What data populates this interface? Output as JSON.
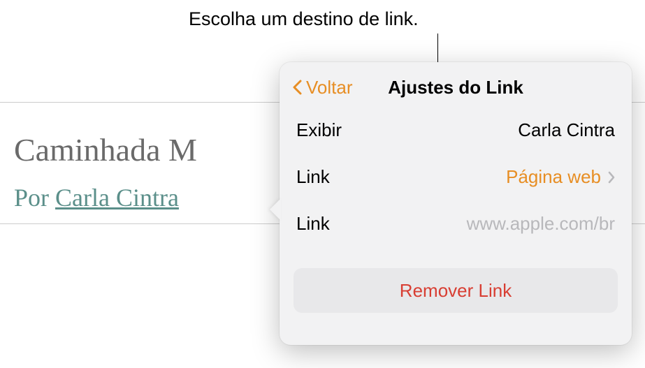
{
  "caption": "Escolha um destino de link.",
  "document": {
    "title": "Caminhada M",
    "author_prefix": "Por ",
    "author_name": "Carla Cintra"
  },
  "popover": {
    "back_label": "Voltar",
    "title": "Ajustes do Link",
    "rows": {
      "display": {
        "label": "Exibir",
        "value": "Carla Cintra"
      },
      "link_type": {
        "label": "Link",
        "value": "Página web"
      },
      "link_url": {
        "label": "Link",
        "placeholder": "www.apple.com/br"
      }
    },
    "remove_button": "Remover Link"
  }
}
